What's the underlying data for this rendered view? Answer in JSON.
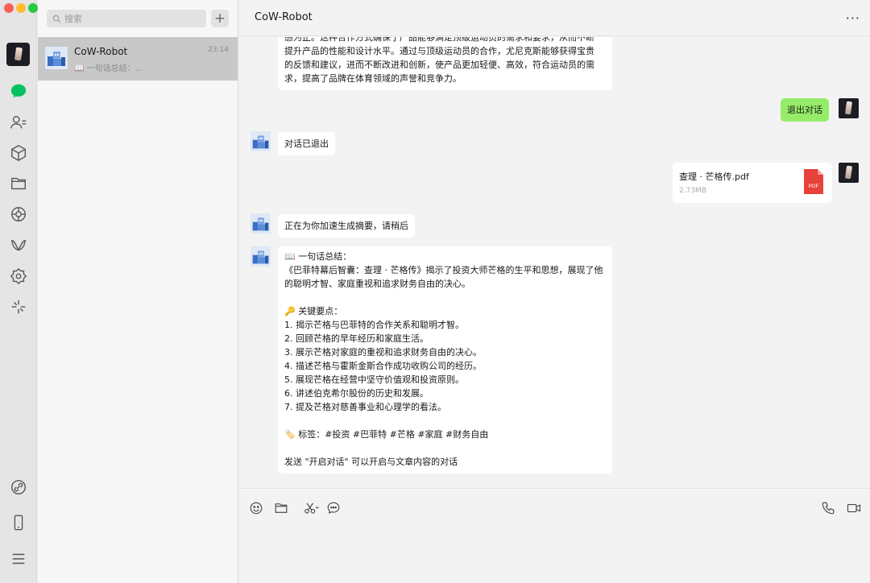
{
  "search": {
    "placeholder": "搜索"
  },
  "add_button": "+",
  "conversation": {
    "name": "CoW-Robot",
    "time": "23:14",
    "preview": "📖 一句话总结：..."
  },
  "chat": {
    "title": "CoW-Robot",
    "more": "···"
  },
  "messages": {
    "m1": "感为止。这种合作方式确保了产品能够满足顶级运动员的需求和要求，从而不断\n提升产品的性能和设计水平。通过与顶级运动员的合作，尤尼克斯能够获得宝贵\n的反馈和建议，进而不断改进和创新，使产品更加轻便、高效，符合运动员的需\n求，提高了品牌在体育领域的声誉和竞争力。",
    "m2": "退出对话",
    "m3": "对话已退出",
    "file_name": "查理 · 芒格传.pdf",
    "file_size": "2.73MB",
    "file_badge": "PDF",
    "m4": "正在为你加速生成摘要，请稍后",
    "m5": "📖 一句话总结：\n《巴菲特幕后智囊：查理 · 芒格传》揭示了投资大师芒格的生平和思想，展现了他\n的聪明才智、家庭重视和追求财务自由的决心。\n\n🔑 关键要点：\n1. 揭示芒格与巴菲特的合作关系和聪明才智。\n2. 回顾芒格的早年经历和家庭生活。\n3. 展示芒格对家庭的重视和追求财务自由的决心。\n4. 描述芒格与霍斯金斯合作成功收购公司的经历。\n5. 展现芒格在经营中坚守价值观和投资原则。\n6. 讲述伯克希尔股份的历史和发展。\n7. 提及芒格对慈善事业和心理学的看法。\n\n🏷️ 标签：#投资 #巴菲特 #芒格 #家庭 #财务自由\n\n发送 \"开启对话\" 可以开启与文章内容的对话"
  },
  "colors": {
    "accent": "#07c160",
    "bubble_self": "#95ec69",
    "pdf": "#e8403a"
  },
  "icons": [
    "chat-icon",
    "contacts-icon",
    "box-icon",
    "folder-icon",
    "moments-icon",
    "channels-icon",
    "mini-programs-icon",
    "search-spark-icon",
    "link-icon",
    "phone-icon",
    "menu-icon"
  ]
}
